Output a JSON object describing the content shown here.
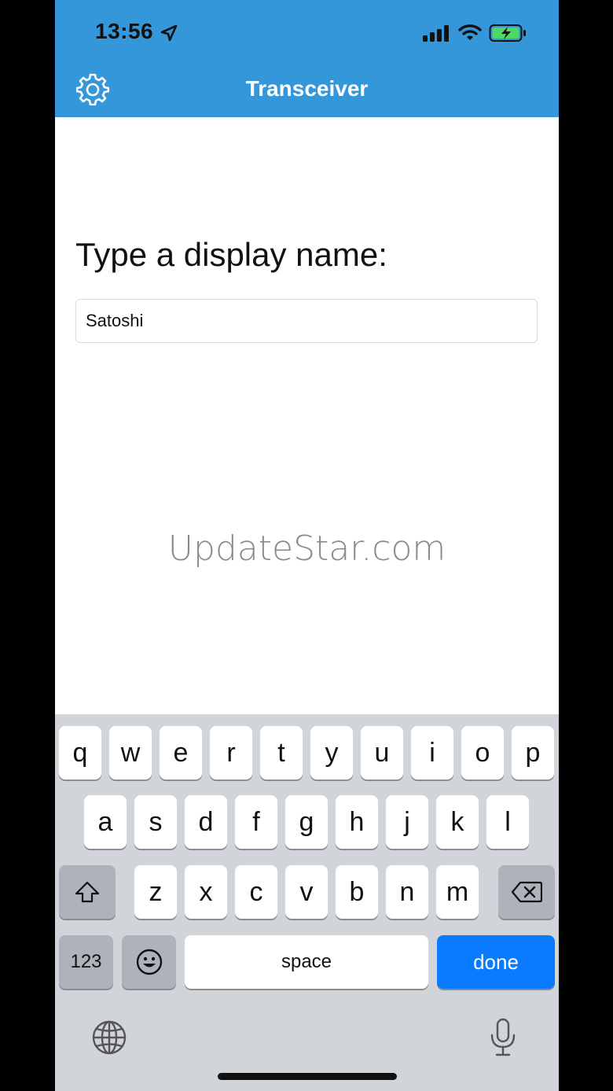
{
  "status_bar": {
    "time": "13:56"
  },
  "header": {
    "title": "Transceiver",
    "accent_color": "#3497da"
  },
  "content": {
    "prompt": "Type a display name:",
    "name_value": "Satoshi"
  },
  "watermark": "UpdateStar.com",
  "keyboard": {
    "row1": [
      "q",
      "w",
      "e",
      "r",
      "t",
      "y",
      "u",
      "i",
      "o",
      "p"
    ],
    "row2": [
      "a",
      "s",
      "d",
      "f",
      "g",
      "h",
      "j",
      "k",
      "l"
    ],
    "row3": [
      "z",
      "x",
      "c",
      "v",
      "b",
      "n",
      "m"
    ],
    "numbers_label": "123",
    "space_label": "space",
    "done_label": "done",
    "done_color": "#0a7aff"
  },
  "icons": [
    "location-arrow-icon",
    "signal-icon",
    "wifi-icon",
    "battery-charging-icon",
    "gear-icon",
    "shift-icon",
    "backspace-icon",
    "emoji-icon",
    "globe-icon",
    "microphone-icon"
  ]
}
